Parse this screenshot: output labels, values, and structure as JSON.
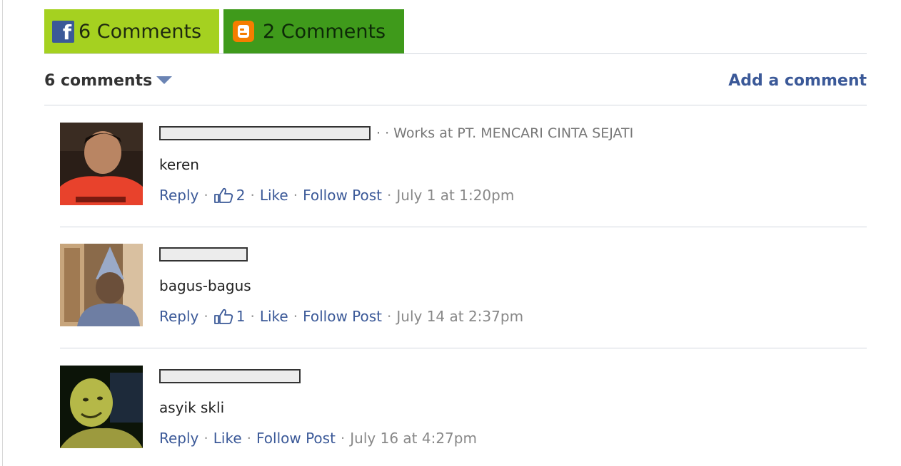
{
  "tabs": [
    {
      "icon": "facebook-icon",
      "label": "6 Comments"
    },
    {
      "icon": "blogger-icon",
      "label": "2 Comments"
    }
  ],
  "header": {
    "count_label": "6 comments",
    "add_comment": "Add a comment"
  },
  "colors": {
    "fb_tab": "#a5d120",
    "blogger_tab": "#3f9a1b",
    "link": "#3b5998"
  },
  "actions": {
    "reply": "Reply",
    "like": "Like",
    "follow": "Follow Post",
    "sep": "·"
  },
  "comments": [
    {
      "meta": "· · Works at PT. MENCARI CINTA SEJATI",
      "text": "keren",
      "likes": "2",
      "time": "July 1 at 1:20pm"
    },
    {
      "meta": "",
      "text": "bagus-bagus",
      "likes": "1",
      "time": "July 14 at 2:37pm"
    },
    {
      "meta": "",
      "text": "asyik skli",
      "likes": "",
      "time": "July 16 at 4:27pm"
    }
  ]
}
